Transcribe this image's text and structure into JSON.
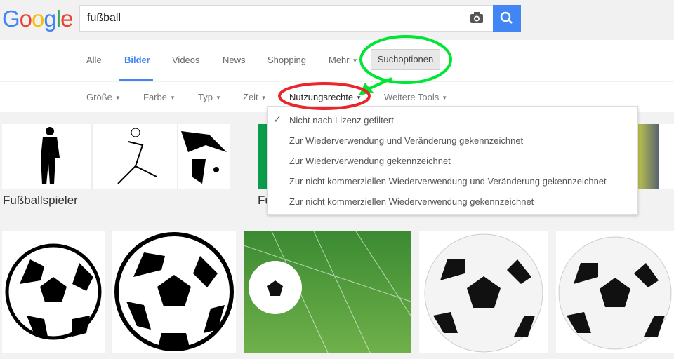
{
  "logo": {
    "text": "Google",
    "letters": [
      {
        "c": "G",
        "color": "#4285f4"
      },
      {
        "c": "o",
        "color": "#ea4335"
      },
      {
        "c": "o",
        "color": "#fbbc05"
      },
      {
        "c": "g",
        "color": "#4285f4"
      },
      {
        "c": "l",
        "color": "#34a853"
      },
      {
        "c": "e",
        "color": "#ea4335"
      }
    ]
  },
  "search": {
    "value": "fußball",
    "camera_icon": "camera-icon",
    "button_icon": "search-icon"
  },
  "nav": {
    "tabs": [
      "Alle",
      "Bilder",
      "Videos",
      "News",
      "Shopping",
      "Mehr"
    ],
    "active": "Bilder",
    "search_options": "Suchoptionen"
  },
  "tools": [
    "Größe",
    "Farbe",
    "Typ",
    "Zeit",
    "Nutzungsrechte",
    "Weitere Tools"
  ],
  "related": [
    {
      "label": "Fußballspieler"
    },
    {
      "label": "Fu"
    }
  ],
  "license_menu": {
    "selected": 0,
    "items": [
      "Nicht nach Lizenz gefiltert",
      "Zur Wiederverwendung und Veränderung gekennzeichnet",
      "Zur Wiederverwendung gekennzeichnet",
      "Zur nicht kommerziellen Wiederverwendung und Veränderung gekennzeichnet",
      "Zur nicht kommerziellen Wiederverwendung gekennzeichnet"
    ]
  },
  "annotations": {
    "green": "#00e632",
    "red": "#e8262b"
  }
}
